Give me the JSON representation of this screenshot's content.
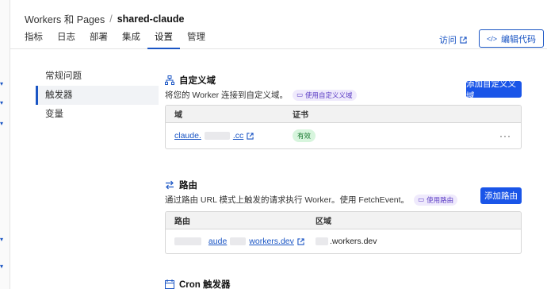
{
  "breadcrumb": {
    "parent": "Workers 和 Pages",
    "separator": "/",
    "current": "shared-claude"
  },
  "tabs": [
    "指标",
    "日志",
    "部署",
    "集成",
    "设置",
    "管理"
  ],
  "active_tab": "设置",
  "header_actions": {
    "visit": "访问",
    "edit_code": "编辑代码"
  },
  "side_nav": [
    "常规问题",
    "触发器",
    "变量"
  ],
  "active_side": "触发器",
  "custom_domain": {
    "title": "自定义域",
    "description": "将您的 Worker 连接到自定义域。",
    "doc_link": "使用自定义义域",
    "add_button": "添加自定义义域",
    "columns": [
      "域",
      "证书"
    ],
    "rows": [
      {
        "domain": "claude.",
        "domain_suffix": ".cc",
        "cert": "有效",
        "more": "···"
      }
    ]
  },
  "routes": {
    "title": "路由",
    "description": "通过路由 URL 模式上触发的请求执行 Worker。使用 FetchEvent。",
    "doc_link": "使用路由",
    "add_button": "添加路由",
    "columns": [
      "路由",
      "区域"
    ],
    "rows": [
      {
        "route_prefix": "aude",
        "route_suffix": "workers.dev",
        "zone": ".workers.dev"
      }
    ]
  },
  "cron": {
    "title": "Cron 触发器"
  },
  "colors": {
    "accent": "#1a55c4",
    "primary_button": "#1a55e8",
    "badge_bg": "#d7f5dd",
    "badge_text": "#1c7a33"
  }
}
